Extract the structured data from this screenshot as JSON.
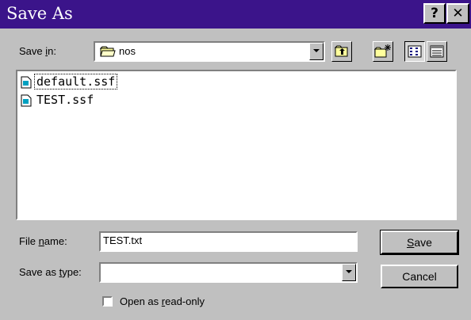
{
  "window": {
    "title": "Save As",
    "help_glyph": "?",
    "close_glyph": "✕"
  },
  "save_in": {
    "label_prefix": "Save ",
    "label_mnemonic": "i",
    "label_suffix": "n:",
    "value": "nos",
    "icon": "folder-icon"
  },
  "toolbar": {
    "buttons": [
      {
        "name": "up-one-level",
        "icon": "folder-up-icon"
      },
      {
        "name": "create-new-folder",
        "icon": "new-folder-icon"
      },
      {
        "name": "list-view",
        "icon": "list-view-icon",
        "pressed": true
      },
      {
        "name": "details-view",
        "icon": "details-view-icon",
        "pressed": false
      }
    ]
  },
  "files": [
    {
      "name": "default.ssf",
      "icon": "document-icon",
      "focused": true
    },
    {
      "name": "TEST.ssf",
      "icon": "document-icon",
      "focused": false
    }
  ],
  "file_name": {
    "label_prefix": "File ",
    "label_mnemonic": "n",
    "label_suffix": "ame:",
    "value": "TEST.txt"
  },
  "save_as_type": {
    "label_prefix": "Save as ",
    "label_mnemonic": "t",
    "label_suffix": "ype:",
    "value": ""
  },
  "read_only": {
    "label_prefix": "Open as ",
    "label_mnemonic": "r",
    "label_suffix": "ead-only",
    "checked": false
  },
  "buttons": {
    "save_mnemonic": "S",
    "save_rest": "ave",
    "cancel": "Cancel"
  },
  "colors": {
    "titlebar": "#3b148a",
    "face": "#c0c0c0"
  }
}
